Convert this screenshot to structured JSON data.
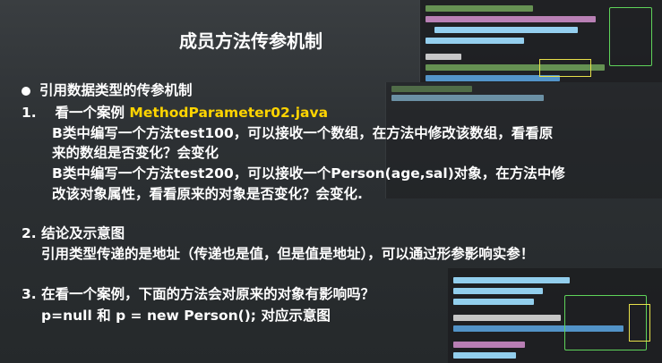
{
  "title": "成员方法传参机制",
  "bullet_heading": "引用数据类型的传参机制",
  "item1": {
    "number": "1.",
    "prefix": "看一个案例 ",
    "highlight": "MethodParameter02.java",
    "line1": "B类中编写一个方法test100，可以接收一个数组，在方法中修改该数组，看看原",
    "line2": "来的数组是否变化？会变化",
    "line3": "B类中编写一个方法test200，可以接收一个Person(age,sal)对象，在方法中修",
    "line4": "改该对象属性，看看原来的对象是否变化？会变化."
  },
  "item2": {
    "heading": "2. 结论及示意图",
    "line1": "引用类型传递的是地址（传递也是值，但是值是地址），可以通过形参影响实参！"
  },
  "item3": {
    "heading": "3. 在看一个案例，下面的方法会对原来的对象有影响吗？",
    "line1": "p=null  和 p = new Person(); 对应示意图"
  },
  "colors": {
    "highlight": "#ffd400",
    "text": "#ffffff",
    "background": "#2c3033"
  }
}
